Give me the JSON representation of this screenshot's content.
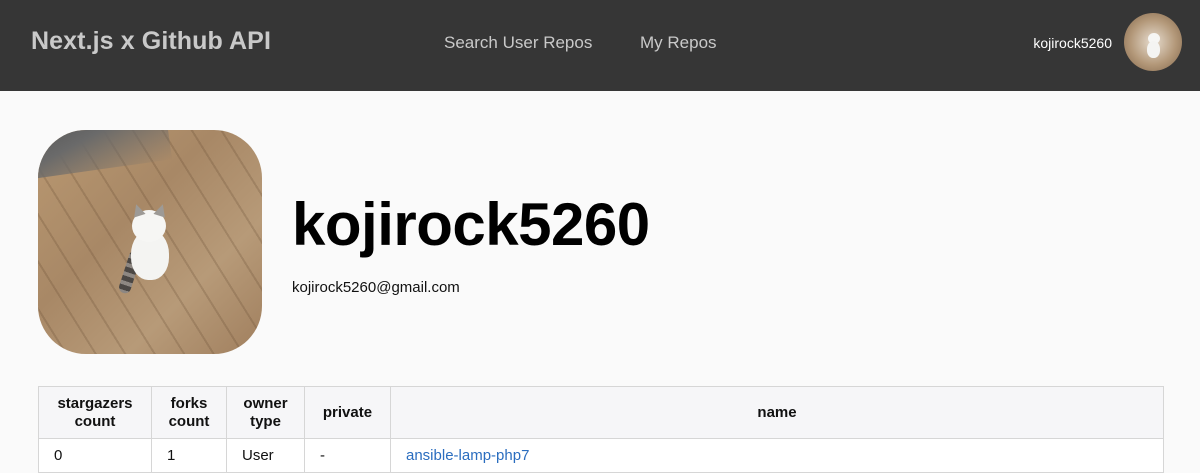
{
  "navbar": {
    "brand": "Next.js x Github API",
    "links": [
      {
        "label": "Search User Repos"
      },
      {
        "label": "My Repos"
      }
    ],
    "username": "kojirock5260"
  },
  "profile": {
    "username": "kojirock5260",
    "email": "kojirock5260@gmail.com"
  },
  "repo_table": {
    "headers": [
      "stargazers count",
      "forks count",
      "owner type",
      "private",
      "name"
    ],
    "rows": [
      {
        "stargazers_count": "0",
        "forks_count": "1",
        "owner_type": "User",
        "private": "-",
        "name": "ansible-lamp-php7"
      }
    ]
  },
  "colors": {
    "navbar_bg": "#363636",
    "link": "#2a6dbf",
    "page_bg": "#fafafa"
  },
  "icons": {
    "nav_avatar": "user-avatar-cat-photo",
    "profile_avatar": "user-avatar-cat-photo"
  }
}
